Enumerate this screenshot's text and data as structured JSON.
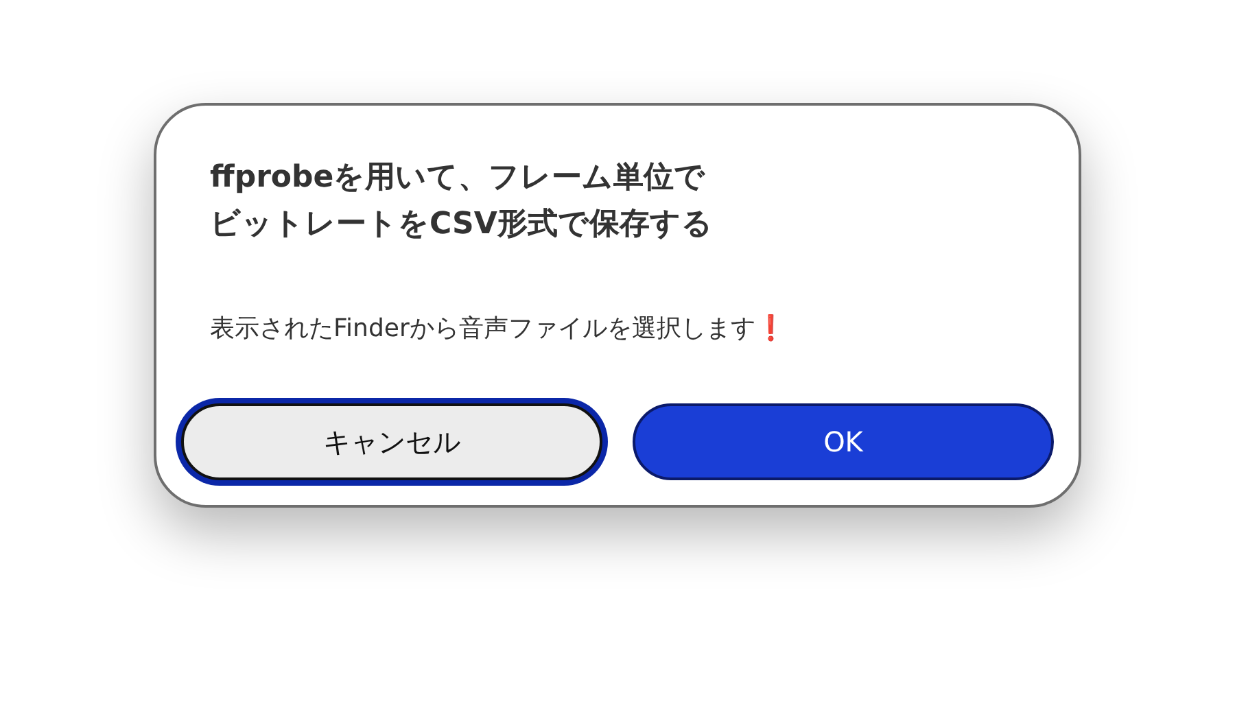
{
  "dialog": {
    "title_lines": [
      "ffprobeを用いて、フレーム単位で",
      "ビットレートをCSV形式で保存する"
    ],
    "message": "表示されたFinderから音声ファイルを選択します❗",
    "buttons": [
      {
        "label": "キャンセル",
        "kind": "cancel",
        "focused": true
      },
      {
        "label": "OK",
        "kind": "default",
        "focused": false
      }
    ]
  }
}
